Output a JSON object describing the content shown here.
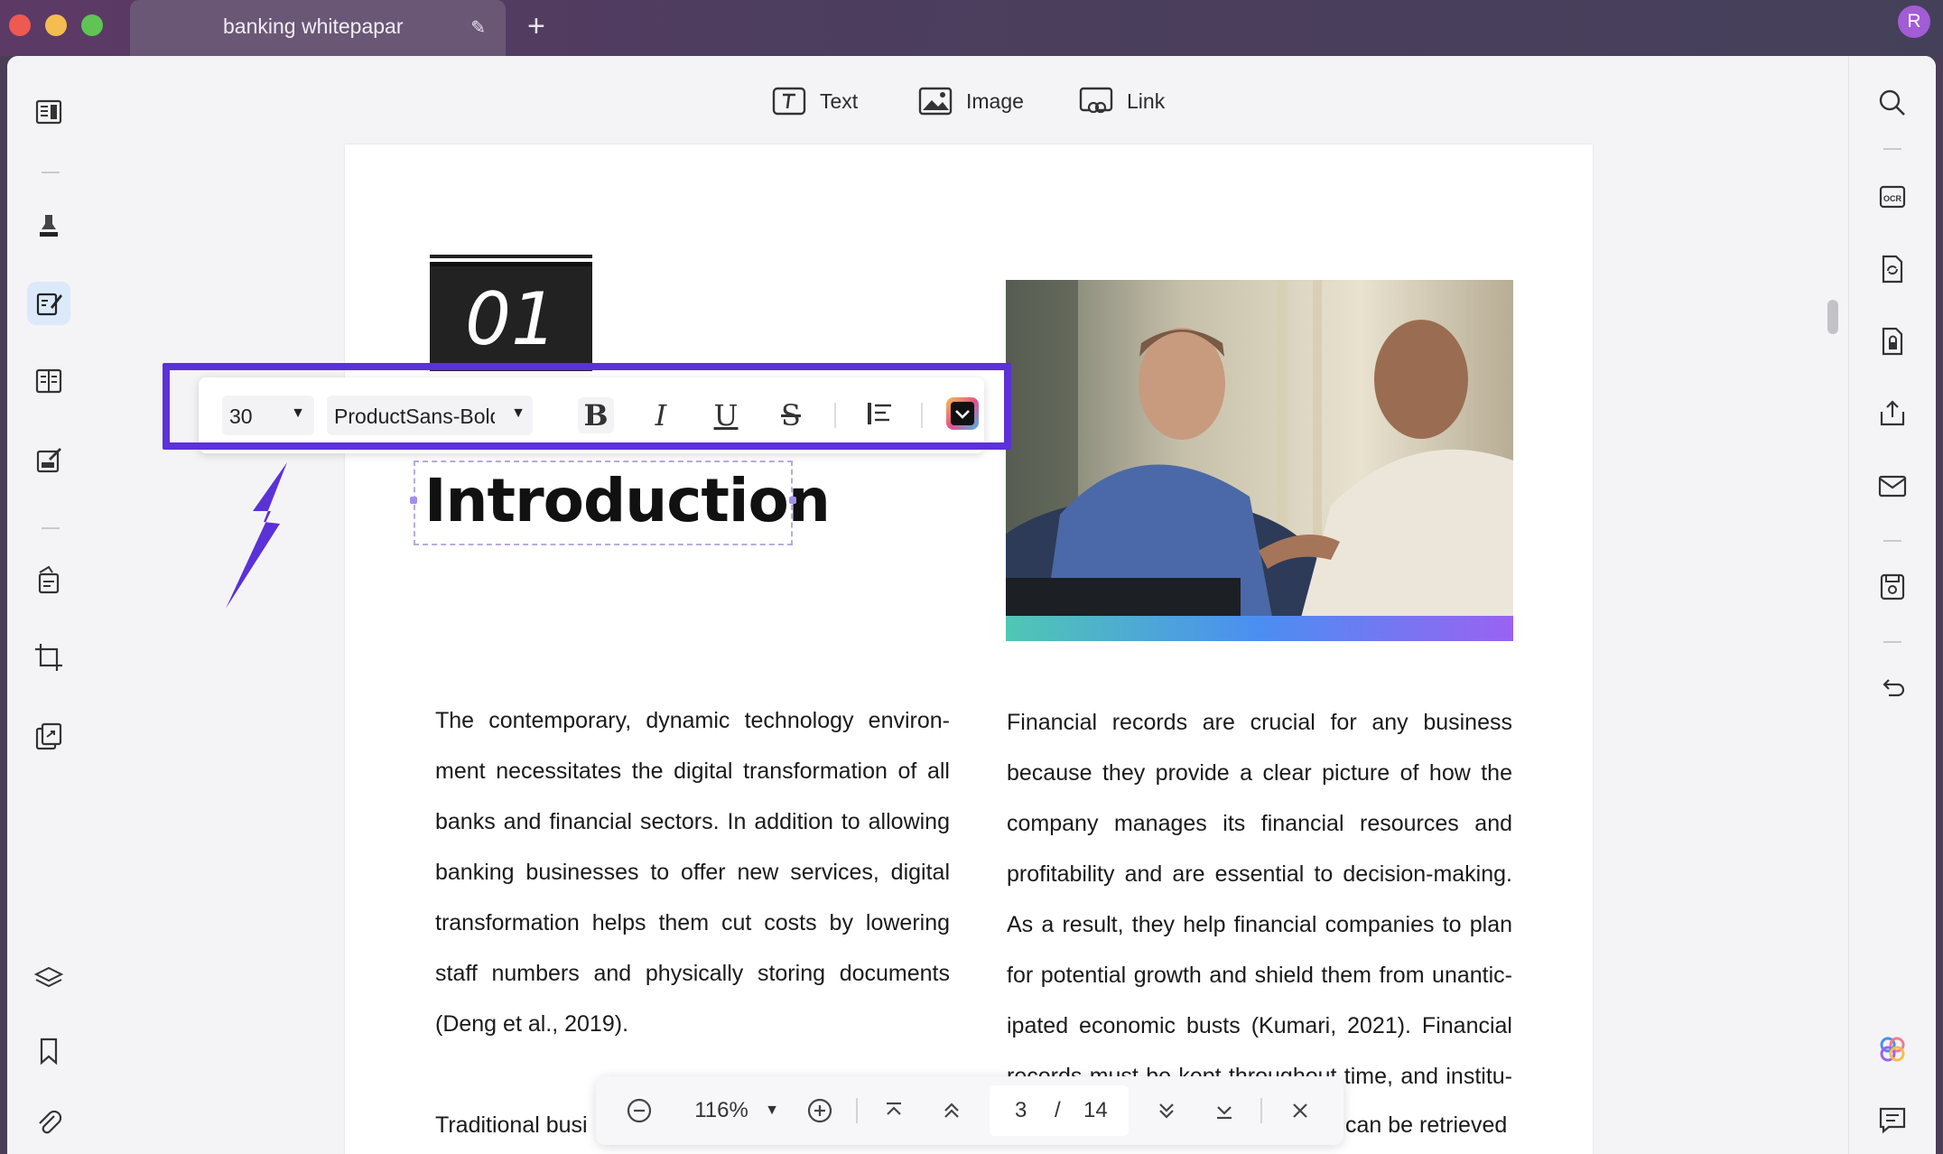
{
  "window": {
    "tab_title": "banking whitepapar",
    "avatar_initial": "R",
    "traffic_colors": [
      "#ee5a52",
      "#f5bd4f",
      "#5fc454"
    ]
  },
  "toolbar": {
    "items": [
      {
        "label": "Text",
        "icon": "text-box-icon"
      },
      {
        "label": "Image",
        "icon": "image-icon"
      },
      {
        "label": "Link",
        "icon": "link-icon"
      }
    ]
  },
  "format_bar": {
    "font_size": "30",
    "font_family": "ProductSans-Bold",
    "bold": "B",
    "italic": "I",
    "underline": "U",
    "strikethrough": "S",
    "highlight_color": "#5b31d8"
  },
  "document": {
    "section_number": "01",
    "heading": "Introduction",
    "left_paragraph_lines": [
      "The contemporary, dynamic technology environ-",
      "ment necessitates the digital transformation of all",
      "banks and financial sectors. In addition to allowing",
      "banking businesses to offer new services, digital",
      "transformation helps them cut costs by lowering",
      "staff numbers and physically storing documents",
      "(Deng et al., 2019)."
    ],
    "left_paragraph2_start": "Traditional busi",
    "right_paragraph_lines": [
      "Financial records are crucial for any business",
      "because they provide a clear picture of how the",
      "company manages its financial resources and",
      "profitability and are essential to decision-making.",
      "As a result, they help financial companies to plan",
      "for potential growth and shield them from unantic-",
      "ipated economic busts (Kumari, 2021). Financial",
      "records must be kept throughout time, and institu-"
    ],
    "right_last_visible": "can be retrieved"
  },
  "navigation": {
    "zoom": "116%",
    "current_page": "3",
    "separator": "/",
    "total_pages": "14"
  }
}
